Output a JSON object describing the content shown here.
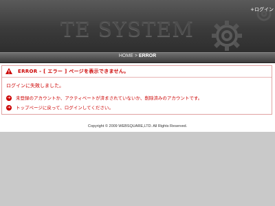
{
  "header": {
    "brand_text": "TE SYSTEM",
    "login_label": "+ログイン"
  },
  "breadcrumb": {
    "home": "HOME",
    "separator": ">",
    "current": "ERROR"
  },
  "error": {
    "title": "ERROR - [ エラー ] ページを表示できません。",
    "message": "ログインに失敗しました。",
    "items": [
      {
        "icon": "arrow-right-circle-icon",
        "text": "未登録のアカウントか、アクティベートが済まされていないか、削除済みのアカウントです。"
      },
      {
        "icon": "arrow-right-circle-icon",
        "text": "トップページに戻って、ログインしてください。"
      }
    ]
  },
  "footer": {
    "copyright": "Copyright © 2009 WEBSQUARE,LTD. All Rights Reserved."
  },
  "colors": {
    "error_red": "#cc0000",
    "header_dark": "#3b3b3b",
    "background_gray": "#c9c9c9"
  }
}
